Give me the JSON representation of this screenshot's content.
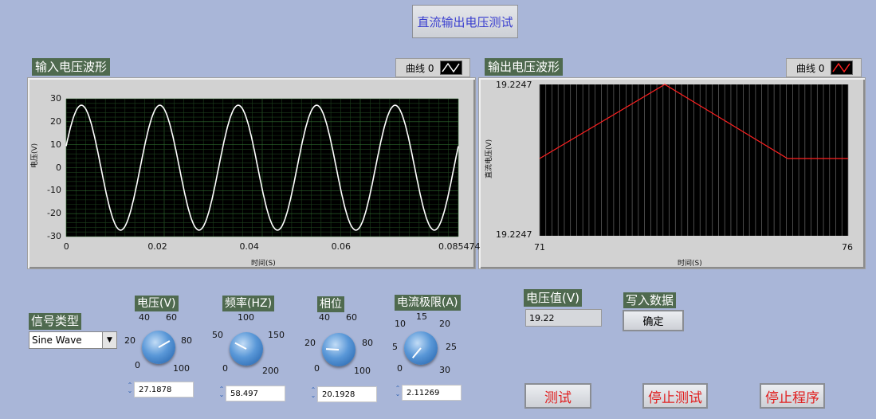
{
  "title_button": "直流输出电压测试",
  "input_graph": {
    "label": "输入电压波形",
    "legend": "曲线 0",
    "ylabel": "电压(V)",
    "xlabel": "时间(S)",
    "yticks": [
      "30",
      "20",
      "10",
      "0",
      "-10",
      "-20",
      "-30"
    ],
    "xticks": [
      "0",
      "0.02",
      "0.04",
      "0.06",
      "0.085474"
    ],
    "line_color": "#ffffff",
    "chart_data": {
      "type": "line",
      "amplitude": 27.1878,
      "frequency": 58.497,
      "phase_deg": 20.1928,
      "xlim": [
        0,
        0.085474
      ],
      "ylim": [
        -30,
        30
      ]
    }
  },
  "output_graph": {
    "label": "输出电压波形",
    "legend": "曲线 0",
    "ylabel": "直流电压(V)",
    "xlabel": "时间(S)",
    "ytop": "19.2247",
    "ybottom": "19.2247",
    "xstart": "71",
    "xend": "76",
    "line_color": "#ff2020"
  },
  "signal_type": {
    "label": "信号类型",
    "value": "Sine Wave"
  },
  "knobs": [
    {
      "label": "电压(V)",
      "value": "27.1878",
      "ticks": [
        "40",
        "60",
        "20",
        "80",
        "0",
        "100"
      ]
    },
    {
      "label": "频率(HZ)",
      "value": "58.497",
      "ticks": [
        "100",
        "50",
        "150",
        "0",
        "200"
      ]
    },
    {
      "label": "相位",
      "value": "20.1928",
      "ticks": [
        "40",
        "60",
        "20",
        "80",
        "0",
        "100"
      ]
    },
    {
      "label": "电流极限(A)",
      "value": "2.11269",
      "ticks": [
        "15",
        "10",
        "20",
        "5",
        "25",
        "0",
        "30"
      ]
    }
  ],
  "voltage_value": {
    "label": "电压值(V)",
    "value": "19.22"
  },
  "write_data": {
    "label": "写入数据",
    "button": "确定"
  },
  "buttons": {
    "test": "测试",
    "stop_test": "停止测试",
    "stop_program": "停止程序"
  }
}
